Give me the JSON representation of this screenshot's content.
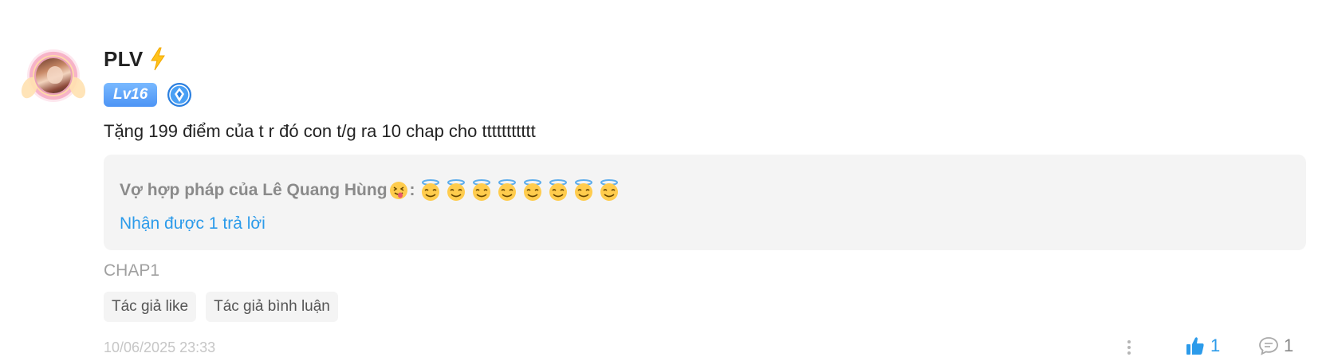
{
  "comment": {
    "username": "PLV",
    "level": "Lv16",
    "text": "Tặng 199 điểm của t r đó con t/g ra 10 chap cho ttttttttttt",
    "reply": {
      "author": "Vợ hợp pháp của Lê Quang Hùng",
      "author_emoji": "squinting-tongue-emoji",
      "separator": ":",
      "content_emoji": "smiling-face-with-halo-emoji",
      "content_emoji_count": 8,
      "count_label": "Nhận được 1 trả lời"
    },
    "chapter": "CHAP1",
    "tags": [
      "Tác giả like",
      "Tác giả bình luận"
    ],
    "timestamp": "10/06/2025 23:33",
    "likes": "1",
    "replies": "1"
  },
  "colors": {
    "accent": "#2c9bea",
    "level_badge": "#4d94f5",
    "reply_bg": "#f4f4f4",
    "muted": "#a0a0a0"
  },
  "icons": {
    "bolt": "lightning-bolt-icon",
    "rank": "rank-badge-icon",
    "more": "more-vertical-icon",
    "like": "thumbs-up-icon",
    "reply": "comment-bubble-icon"
  }
}
